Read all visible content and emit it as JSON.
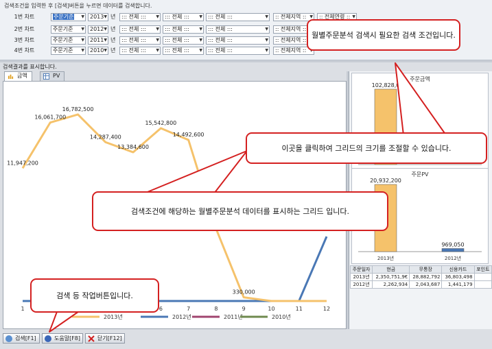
{
  "condition": {
    "hint": "검색조건을 입력한 후 [검색]버튼을 누르면 데이터를 검색합니다.",
    "year_unit": "년",
    "rows": [
      {
        "label": "1번 차트",
        "basis": "주문기준",
        "year": "2013",
        "all1": "::: 전체 :::",
        "all2": "::: 전체 :::",
        "all3": "::: 전체 :::",
        "region": ":: 전체지역 ::",
        "age": ":: 전체연령 ::"
      },
      {
        "label": "2번 차트",
        "basis": "주문기준",
        "year": "2012",
        "all1": "::: 전체 :::",
        "all2": "::: 전체 :::",
        "all3": "::: 전체 :::",
        "region": ":: 전체지역 ::",
        "age": ""
      },
      {
        "label": "3번 차트",
        "basis": "주문기준",
        "year": "2011",
        "all1": "::: 전체 :::",
        "all2": "::: 전체 :::",
        "all3": "::: 전체 :::",
        "region": ":: 전체지역 ::",
        "age": ""
      },
      {
        "label": "4번 차트",
        "basis": "주문기준",
        "year": "2010",
        "all1": "::: 전체 :::",
        "all2": "::: 전체 :::",
        "all3": "::: 전체 :::",
        "region": ":: 전체지역 ::",
        "age": ""
      }
    ]
  },
  "result_hint": "검색결과를 표시합니다.",
  "tabs": [
    {
      "label": "금액"
    },
    {
      "label": "PV"
    }
  ],
  "chart_data": [
    {
      "type": "line",
      "x": [
        1,
        2,
        3,
        4,
        5,
        6,
        7,
        8,
        9,
        10,
        11,
        12
      ],
      "series": [
        {
          "name": "2013년",
          "color": "#f5c26b",
          "values": [
            11947200,
            16061700,
            16782500,
            14287400,
            13384600,
            15542800,
            14492600,
            6500000,
            330000,
            0,
            0,
            0
          ]
        },
        {
          "name": "2012년",
          "color": "#4a78b5",
          "values": [
            0,
            0,
            0,
            0,
            0,
            0,
            0,
            0,
            0,
            0,
            0,
            5800000
          ]
        },
        {
          "name": "2011년",
          "color": "#a0446f",
          "values": [
            0,
            0,
            0,
            0,
            0,
            0,
            0,
            0,
            0,
            0,
            0,
            0
          ]
        },
        {
          "name": "2010년",
          "color": "#6f8a4e",
          "values": [
            0,
            0,
            0,
            0,
            0,
            0,
            0,
            0,
            0,
            0,
            0,
            0
          ]
        }
      ],
      "data_labels": [
        "11,947,200",
        "16,061,700",
        "16,782,500",
        "14,287,400",
        "13,384,600",
        "15,542,800",
        "14,492,600",
        "",
        "330,000"
      ],
      "ylim": [
        0,
        19000000
      ],
      "legend": "bottom"
    },
    {
      "type": "bar",
      "title": "주문금액",
      "categories": [
        "2013년",
        "2012년"
      ],
      "values": [
        102828000,
        0
      ],
      "data_labels": [
        "102,828,0",
        ""
      ],
      "color": "#f5c26b"
    },
    {
      "type": "bar",
      "title": "주문PV",
      "categories": [
        "2013년",
        "2012년"
      ],
      "values": [
        20932200,
        969050
      ],
      "data_labels": [
        "20,932,200",
        "969,050"
      ],
      "colors": [
        "#f5c26b",
        "#4a78b5"
      ]
    }
  ],
  "summary_table": {
    "headers": [
      "주문일자",
      "현금",
      "무통장",
      "신용카드",
      "포인트"
    ],
    "rows": [
      [
        "2013년",
        "2,350,751,9€",
        "28,882,792",
        "36,803,498",
        ""
      ],
      [
        "2012년",
        "2,262,934",
        "2,043,687",
        "1,441,179",
        ""
      ]
    ]
  },
  "buttons": {
    "search": "검색[F1]",
    "help": "도움말[F8]",
    "close": "닫기[F12]"
  },
  "callouts": {
    "condition": "월별주문분석 검색시 필요한 검색 조건입니다.",
    "resize": "이곳을 클릭하여 그리드의 크기를 조절할 수 있습니다.",
    "grid": "검색조건에 해당하는 월별주문분석 데이터를 표시하는 그리드 입니다.",
    "buttons": "검색 등 작업버튼입니다."
  },
  "colors": {
    "callout_border": "#d42020",
    "accent": "#3a72c4"
  }
}
